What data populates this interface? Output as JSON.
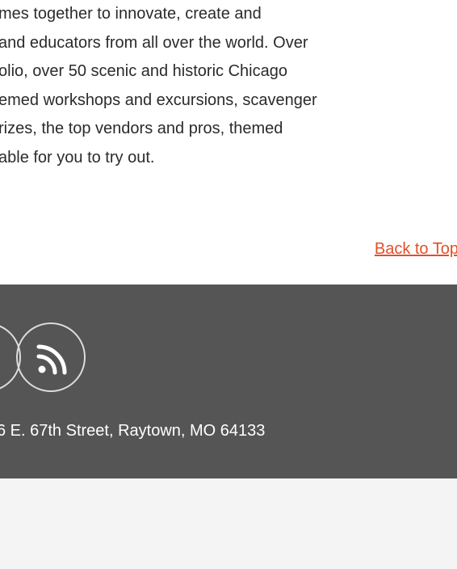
{
  "article": {
    "lines": [
      "mes together to innovate, create and",
      "and educators from all over the world. Over",
      "olio, over 50 scenic and historic Chicago",
      "emed workshops and excursions, scavenger",
      "rizes, the top vendors and pros, themed",
      "able for you to try out."
    ]
  },
  "back_to_top": {
    "label": "Back to Top"
  },
  "footer": {
    "icons": [
      "social-icon",
      "rss-icon"
    ],
    "address": "6 E. 67th Street, Raytown, MO 64133"
  },
  "colors": {
    "link": "#e0502a",
    "footer_bg": "#555555",
    "text": "#2b2b2b"
  }
}
